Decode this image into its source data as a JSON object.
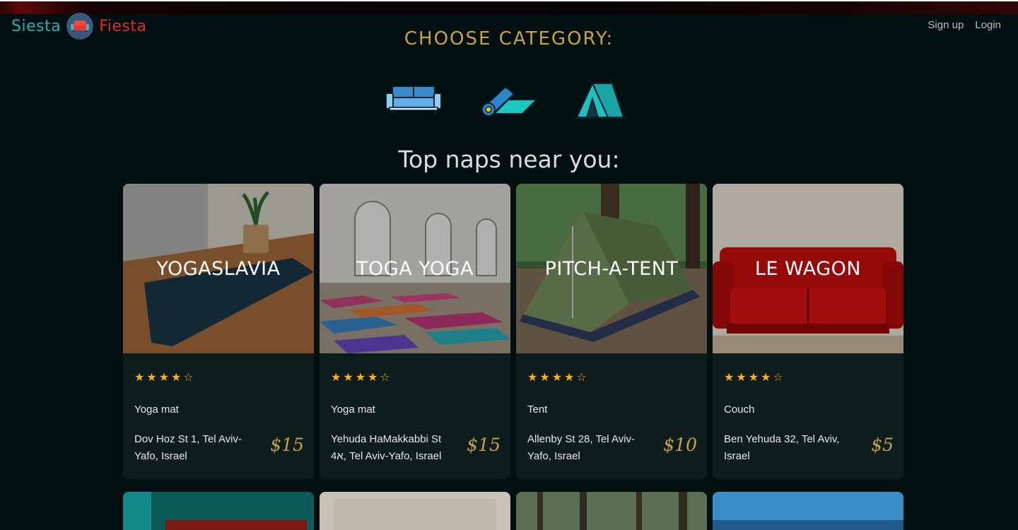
{
  "brand": {
    "left": "Siesta",
    "right": "Fiesta",
    "logo_icon": "couch-icon"
  },
  "nav": {
    "signup": "Sign up",
    "login": "Login"
  },
  "categories": {
    "title": "CHOOSE CATEGORY:",
    "items": [
      {
        "name": "couch",
        "icon": "couch-icon"
      },
      {
        "name": "yoga mat",
        "icon": "yoga-mat-icon"
      },
      {
        "name": "tent",
        "icon": "tent-icon"
      }
    ]
  },
  "top_naps": {
    "title": "Top naps near you:",
    "cards": [
      {
        "title": "Yogaslavia",
        "rating": 4,
        "type": "Yoga mat",
        "address": "Dov Hoz St 1, Tel Aviv-Yafo, Israel",
        "price": "$15"
      },
      {
        "title": "Toga Yoga",
        "rating": 4,
        "type": "Yoga mat",
        "address": "Yehuda HaMakkabbi St 4א, Tel Aviv-Yafo, Israel",
        "price": "$15"
      },
      {
        "title": "Pitch-a-tent",
        "rating": 4,
        "type": "Tent",
        "address": "Allenby St 28, Tel Aviv-Yafo, Israel",
        "price": "$10"
      },
      {
        "title": "Le Wagon",
        "rating": 4,
        "type": "Couch",
        "address": "Ben Yehuda 32, Tel Aviv, Israel",
        "price": "$5"
      }
    ],
    "star_filled": "★",
    "star_empty": "☆"
  },
  "colors": {
    "accent_gold": "#c8a43a",
    "brand_teal": "#21b3b5",
    "brand_red": "#e12b22",
    "star": "#f5b50a",
    "background": "#010f10"
  }
}
